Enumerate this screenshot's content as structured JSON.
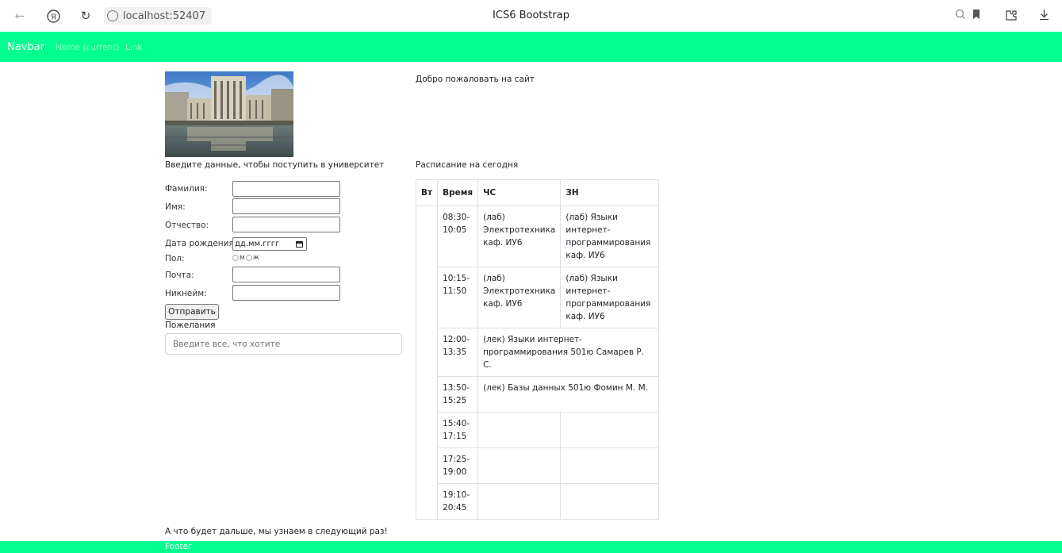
{
  "browser": {
    "url": "localhost:52407",
    "title": "ICS6 Bootstrap",
    "icons": [
      "back-arrow-icon",
      "yandex-icon",
      "reload-icon",
      "site-info-icon",
      "search-icon",
      "bookmark-icon",
      "extension-icon",
      "download-icon"
    ]
  },
  "navbar": {
    "brand": "Navbar",
    "links": [
      "Home (current)",
      "Link"
    ],
    "bg_color": "#00ff8e"
  },
  "left": {
    "intro": "Введите данные, чтобы поступить в университет",
    "fields": {
      "surname": "Фамилия:",
      "name": "Имя:",
      "patronymic": "Отчество:",
      "birthdate": "Дата рождения:",
      "gender": "Пол:",
      "email": "Почта:",
      "nickname": "Никнейм:"
    },
    "birthdate_placeholder": "дд.мм.гггг",
    "gender_options": [
      "м",
      "ж"
    ],
    "submit": "Отправить",
    "wishes_label": "Пожелания",
    "wishes_placeholder": "Введите все, что хотите"
  },
  "right": {
    "welcome": "Добро пожаловать на сайт",
    "schedule_title": "Расписание на сегодня",
    "table": {
      "headers": [
        "Вт",
        "Время",
        "ЧС",
        "ЗН"
      ],
      "rows": [
        {
          "time": "08:30-10:05",
          "ch": "(лаб) Электротехника каф. ИУ6",
          "zn": "(лаб) Языки интернет-программирования каф. ИУ6"
        },
        {
          "time": "10:15-11:50",
          "ch": "(лаб) Электротехника каф. ИУ6",
          "zn": "(лаб) Языки интернет-программирования каф. ИУ6"
        },
        {
          "time": "12:00-13:35",
          "merged": "(лек) Языки интернет-программирования 501ю Самарев Р. С."
        },
        {
          "time": "13:50-15:25",
          "merged": "(лек) Базы данных 501ю Фомин М. М."
        },
        {
          "time": "15:40-17:15",
          "ch": "",
          "zn": ""
        },
        {
          "time": "17:25-19:00",
          "ch": "",
          "zn": ""
        },
        {
          "time": "19:10-20:45",
          "ch": "",
          "zn": ""
        }
      ]
    }
  },
  "footer": {
    "text": "А что будет дальше, мы узнаем в следующий раз!",
    "label": "Footer"
  }
}
